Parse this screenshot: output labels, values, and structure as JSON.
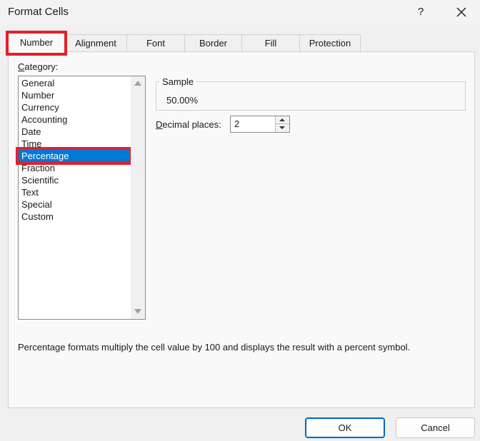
{
  "window": {
    "title": "Format Cells",
    "help_label": "?"
  },
  "tabs": [
    {
      "label": "Number"
    },
    {
      "label": "Alignment"
    },
    {
      "label": "Font"
    },
    {
      "label": "Border"
    },
    {
      "label": "Fill"
    },
    {
      "label": "Protection"
    }
  ],
  "category": {
    "label_first": "C",
    "label_rest": "ategory:",
    "items": [
      "General",
      "Number",
      "Currency",
      "Accounting",
      "Date",
      "Time",
      "Percentage",
      "Fraction",
      "Scientific",
      "Text",
      "Special",
      "Custom"
    ],
    "selected": "Percentage"
  },
  "sample": {
    "label": "Sample",
    "value": "50.00%"
  },
  "decimal_places": {
    "label_first": "D",
    "label_rest": "ecimal places:",
    "value": "2"
  },
  "description": "Percentage formats multiply the cell value by 100 and displays the result with a percent symbol.",
  "buttons": {
    "ok": "OK",
    "cancel": "Cancel"
  },
  "colors": {
    "selection": "#0078d4",
    "highlight_box": "#e3202a",
    "default_button_border": "#0067c0"
  }
}
